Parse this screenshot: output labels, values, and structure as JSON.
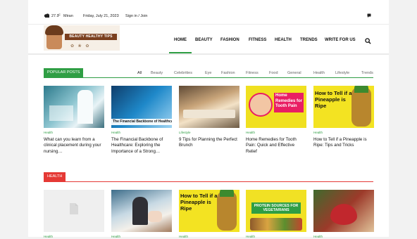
{
  "topbar": {
    "weather_temp": "27.9",
    "weather_unit": "C",
    "weather_city": "Miran",
    "date": "Friday, July 21, 2023",
    "auth_link": "Sign in / Join"
  },
  "logo": {
    "banner_text": "BEAUTY HEALTHY TIPS"
  },
  "nav": {
    "items": [
      "HOME",
      "BEAUTY",
      "FASHION",
      "FITNESS",
      "HEALTH",
      "TRENDS",
      "WRITE FOR US"
    ]
  },
  "popular": {
    "label": "POPULAR POSTS",
    "filters": [
      "All",
      "Beauty",
      "Celebrities",
      "Eye",
      "Fashion",
      "Fitness",
      "Food",
      "General",
      "Health",
      "Lifestyle",
      "Trends"
    ],
    "cards": [
      {
        "category": "Health",
        "title": "What can you learn from a clinical placement during your nursing…",
        "thumb_text": ""
      },
      {
        "category": "Health",
        "title": "The Financial Backbone of Healthcare: Exploring the Importance of a Strong…",
        "thumb_text": "The Financial Backbone of Healthcare"
      },
      {
        "category": "Lifestyle",
        "title": "9 Tips for Planning the Perfect Brunch",
        "thumb_text": ""
      },
      {
        "category": "Health",
        "title": "Home Remedies for Tooth Pain: Quick and Effective Relief",
        "thumb_text": "Home Remedies for Tooth Pain"
      },
      {
        "category": "Health",
        "title": "How to Tell if a Pineapple is Ripe: Tips and Tricks",
        "thumb_text": "How to Tell if a Pineapple is Ripe"
      }
    ]
  },
  "health": {
    "label": "HEALTH",
    "cards": [
      {
        "category": "Health",
        "thumb_text": ""
      },
      {
        "category": "Health",
        "thumb_text": ""
      },
      {
        "category": "Health",
        "thumb_text": "How to Tell if a Pineapple is Ripe"
      },
      {
        "category": "Health",
        "thumb_text": "PROTEIN SOURCES FOR VEGETARIANS"
      },
      {
        "category": "Health",
        "thumb_text": ""
      }
    ]
  },
  "colors": {
    "accent_green": "#2f9e44",
    "accent_red": "#e53935",
    "thumb_yellow": "#f0e020",
    "home_pink": "#e91e63"
  }
}
